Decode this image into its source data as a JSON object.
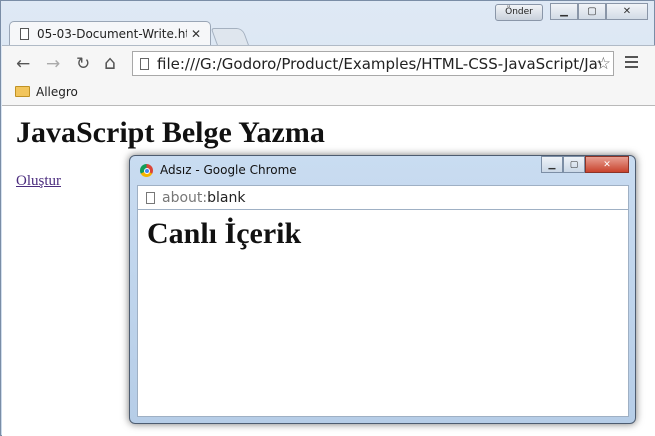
{
  "browser": {
    "tab_title": "05-03-Document-Write.ht",
    "tab_close": "✕",
    "order_button": "Önder",
    "url": "file:///G:/Godoro/Product/Examples/HTML-CSS-JavaScript/Jav",
    "bookmark": "Allegro"
  },
  "page": {
    "heading": "JavaScript Belge Yazma",
    "link": "Oluştur"
  },
  "popup": {
    "title": "Adsız - Google Chrome",
    "url_scheme": "about:",
    "url_rest": "blank",
    "heading": "Canlı İçerik"
  },
  "icons": {
    "back": "←",
    "forward": "→",
    "reload": "↻",
    "home": "⌂",
    "star": "☆"
  }
}
